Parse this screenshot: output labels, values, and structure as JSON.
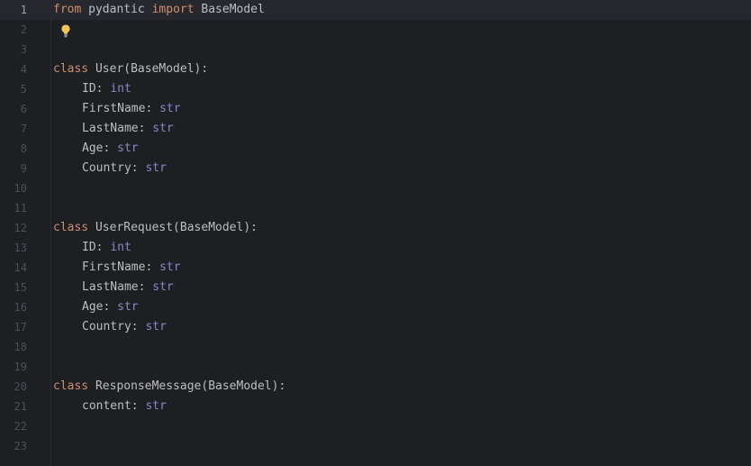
{
  "lines": [
    {
      "n": "1",
      "tokens": [
        {
          "t": "from",
          "c": "kw"
        },
        {
          "t": " pydantic ",
          "c": "plain"
        },
        {
          "t": "import",
          "c": "kw"
        },
        {
          "t": " BaseModel",
          "c": "plain"
        }
      ]
    },
    {
      "n": "2",
      "tokens": []
    },
    {
      "n": "3",
      "tokens": []
    },
    {
      "n": "4",
      "tokens": [
        {
          "t": "class",
          "c": "kw"
        },
        {
          "t": " User(BaseModel):",
          "c": "plain"
        }
      ]
    },
    {
      "n": "5",
      "indent": 1,
      "tokens": [
        {
          "t": "ID: ",
          "c": "plain"
        },
        {
          "t": "int",
          "c": "type"
        }
      ]
    },
    {
      "n": "6",
      "indent": 1,
      "tokens": [
        {
          "t": "FirstName: ",
          "c": "plain"
        },
        {
          "t": "str",
          "c": "type"
        }
      ]
    },
    {
      "n": "7",
      "indent": 1,
      "tokens": [
        {
          "t": "LastName: ",
          "c": "plain"
        },
        {
          "t": "str",
          "c": "type"
        }
      ]
    },
    {
      "n": "8",
      "indent": 1,
      "tokens": [
        {
          "t": "Age: ",
          "c": "plain"
        },
        {
          "t": "str",
          "c": "type"
        }
      ]
    },
    {
      "n": "9",
      "indent": 1,
      "tokens": [
        {
          "t": "Country: ",
          "c": "plain"
        },
        {
          "t": "str",
          "c": "type"
        }
      ]
    },
    {
      "n": "10",
      "tokens": []
    },
    {
      "n": "11",
      "tokens": []
    },
    {
      "n": "12",
      "tokens": [
        {
          "t": "class",
          "c": "kw"
        },
        {
          "t": " UserRequest(BaseModel):",
          "c": "plain"
        }
      ]
    },
    {
      "n": "13",
      "indent": 1,
      "tokens": [
        {
          "t": "ID: ",
          "c": "plain"
        },
        {
          "t": "int",
          "c": "type"
        }
      ]
    },
    {
      "n": "14",
      "indent": 1,
      "tokens": [
        {
          "t": "FirstName: ",
          "c": "plain"
        },
        {
          "t": "str",
          "c": "type"
        }
      ]
    },
    {
      "n": "15",
      "indent": 1,
      "tokens": [
        {
          "t": "LastName: ",
          "c": "plain"
        },
        {
          "t": "str",
          "c": "type"
        }
      ]
    },
    {
      "n": "16",
      "indent": 1,
      "tokens": [
        {
          "t": "Age: ",
          "c": "plain"
        },
        {
          "t": "str",
          "c": "type"
        }
      ]
    },
    {
      "n": "17",
      "indent": 1,
      "tokens": [
        {
          "t": "Country: ",
          "c": "plain"
        },
        {
          "t": "str",
          "c": "type"
        }
      ]
    },
    {
      "n": "18",
      "tokens": []
    },
    {
      "n": "19",
      "tokens": []
    },
    {
      "n": "20",
      "tokens": [
        {
          "t": "class",
          "c": "kw"
        },
        {
          "t": " ResponseMessage(BaseModel):",
          "c": "plain"
        }
      ]
    },
    {
      "n": "21",
      "indent": 1,
      "tokens": [
        {
          "t": "content: ",
          "c": "plain"
        },
        {
          "t": "str",
          "c": "type"
        }
      ]
    },
    {
      "n": "22",
      "tokens": []
    },
    {
      "n": "23",
      "tokens": []
    }
  ],
  "current_line": "1",
  "intention_bulb_line": "2",
  "icons": {
    "intention": "lightbulb-icon"
  },
  "colors": {
    "background": "#1e1f22",
    "current_line": "#26282e",
    "keyword": "#cf8e6d",
    "builtin_type": "#8888c6",
    "text": "#bcbec4",
    "line_number": "#4b5059",
    "bulb": "#f2c55c"
  }
}
